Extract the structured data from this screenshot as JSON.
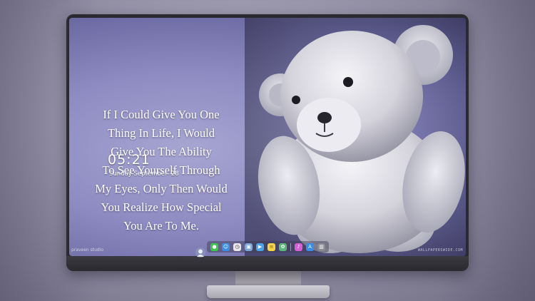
{
  "wallpaper": {
    "quote_lines": [
      "If I Could Give You One",
      "Thing In Life, I Would",
      "Give You The Ability",
      "To See Yourself Through",
      "My Eyes, Only Then Would",
      "You Realize How Special",
      "You Are To Me."
    ],
    "watermark_left": "praveen studio",
    "watermark_right": "WALLPAPERSWIDE.COM"
  },
  "clock": {
    "time": "05:21",
    "date": "Sunday September  28"
  },
  "dock": {
    "items": [
      {
        "icon": "messages-icon",
        "color": "#3fc44d",
        "glyph": "●"
      },
      {
        "icon": "finder-icon",
        "color": "#3d8fe6",
        "glyph": "☺"
      },
      {
        "icon": "clock-icon",
        "color": "#e8e8ec",
        "glyph": "◷"
      },
      {
        "icon": "preview-icon",
        "color": "#7aa6d8",
        "glyph": "▣"
      },
      {
        "icon": "video-icon",
        "color": "#4aa3e8",
        "glyph": "▶"
      },
      {
        "icon": "notes-icon",
        "color": "#f5d547",
        "glyph": "≡"
      },
      {
        "icon": "photos-icon",
        "color": "#5fb67a",
        "glyph": "✿"
      },
      {
        "icon": "itunes-icon",
        "color": "#d45fd6",
        "glyph": "♪"
      },
      {
        "icon": "app-store-icon",
        "color": "#3a8ee8",
        "glyph": "A"
      },
      {
        "icon": "trash-icon",
        "color": "#8a8c94",
        "glyph": "▥"
      }
    ]
  },
  "colors": {
    "screen_background": "#8e8cc2",
    "monitor_frame": "#2b2a30",
    "text": "#ffffff"
  }
}
